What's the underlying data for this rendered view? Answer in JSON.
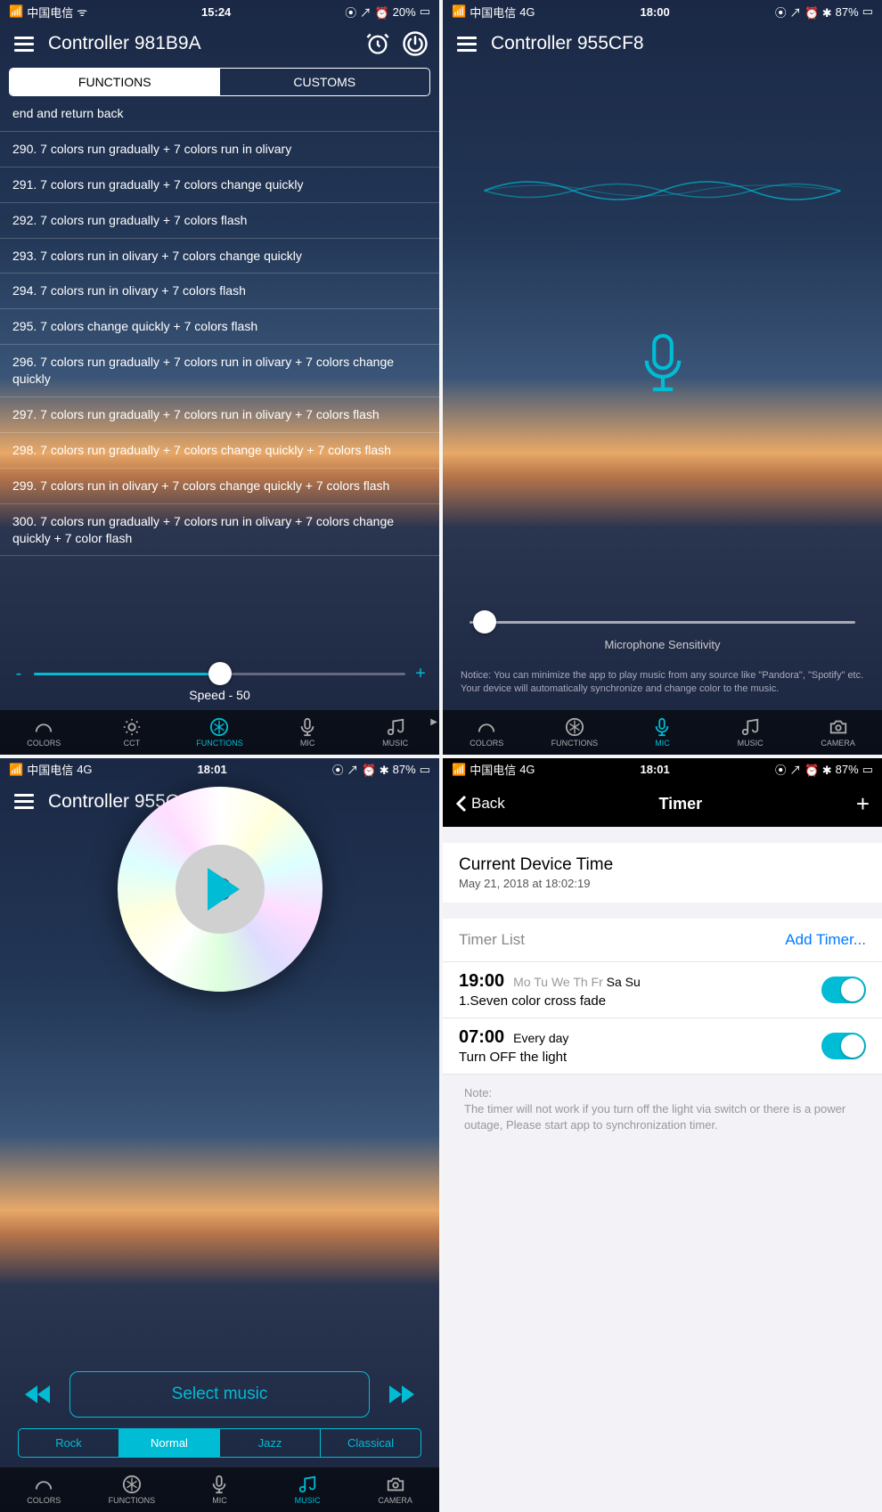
{
  "s1": {
    "status": {
      "carrier": "中国电信",
      "net": "",
      "time": "15:24",
      "battery": "20%",
      "icons": "⦿ ↗ ⏰"
    },
    "title": "Controller 981B9A",
    "tabs": {
      "functions": "FUNCTIONS",
      "customs": "CUSTOMS"
    },
    "items": [
      "end and return back",
      "290. 7 colors run gradually + 7 colors run in olivary",
      "291. 7 colors run gradually + 7 colors change quickly",
      "292. 7 colors run gradually + 7 colors flash",
      "293. 7 colors run in olivary + 7 colors change quickly",
      "294. 7 colors run in olivary + 7 colors flash",
      "295. 7 colors change quickly + 7 colors flash",
      "296. 7 colors run gradually + 7 colors run in olivary + 7 colors change quickly",
      "297. 7 colors run gradually + 7 colors run in olivary + 7 colors flash",
      "298. 7 colors run gradually + 7 colors change quickly + 7 colors flash",
      "299. 7 colors run in olivary + 7 colors change quickly + 7 colors flash",
      "300. 7 colors run gradually + 7 colors run in olivary + 7 colors change quickly + 7 color flash"
    ],
    "speed": {
      "minus": "-",
      "plus": "+",
      "label": "Speed - 50",
      "pct": 50
    },
    "nav": [
      "COLORS",
      "CCT",
      "FUNCTIONS",
      "MIC",
      "MUSIC"
    ],
    "active": 2
  },
  "s2": {
    "status": {
      "carrier": "中国电信",
      "net": "4G",
      "time": "18:00",
      "battery": "87%",
      "icons": "⦿ ↗ ⏰ ✱"
    },
    "title": "Controller 955CF8",
    "slider_label": "Microphone Sensitivity",
    "slider_pct": 4,
    "note": "Notice: You can minimize the app to play music from any source like \"Pandora\", \"Spotify\" etc. Your device will automatically synchronize and change color to the music.",
    "nav": [
      "COLORS",
      "FUNCTIONS",
      "MIC",
      "MUSIC",
      "CAMERA"
    ],
    "active": 2
  },
  "s3": {
    "status": {
      "carrier": "中国电信",
      "net": "4G",
      "time": "18:01",
      "battery": "87%",
      "icons": "⦿ ↗ ⏰ ✱"
    },
    "title": "Controller 955CF8",
    "select_music": "Select music",
    "genres": [
      "Rock",
      "Normal",
      "Jazz",
      "Classical"
    ],
    "genre_active": 1,
    "nav": [
      "COLORS",
      "FUNCTIONS",
      "MIC",
      "MUSIC",
      "CAMERA"
    ],
    "active": 3
  },
  "s4": {
    "status": {
      "carrier": "中国电信",
      "net": "4G",
      "time": "18:01",
      "battery": "87%",
      "icons": "⦿ ↗ ⏰ ✱"
    },
    "back": "Back",
    "title": "Timer",
    "dev_title": "Current Device Time",
    "dev_sub": "May 21, 2018 at 18:02:19",
    "list_label": "Timer List",
    "add": "Add Timer...",
    "timers": [
      {
        "time": "19:00",
        "days_html": "<span>Mo Tu We Th Fr </span><span class='on'>Sa Su</span>",
        "action": "1.Seven color cross fade"
      },
      {
        "time": "07:00",
        "days_html": "<span class='on'>Every day</span>",
        "action": "Turn OFF the light"
      }
    ],
    "note_title": "Note:",
    "note": "The timer will not work if you turn off the light via switch or there is a power outage, Please start app to synchronization timer."
  }
}
